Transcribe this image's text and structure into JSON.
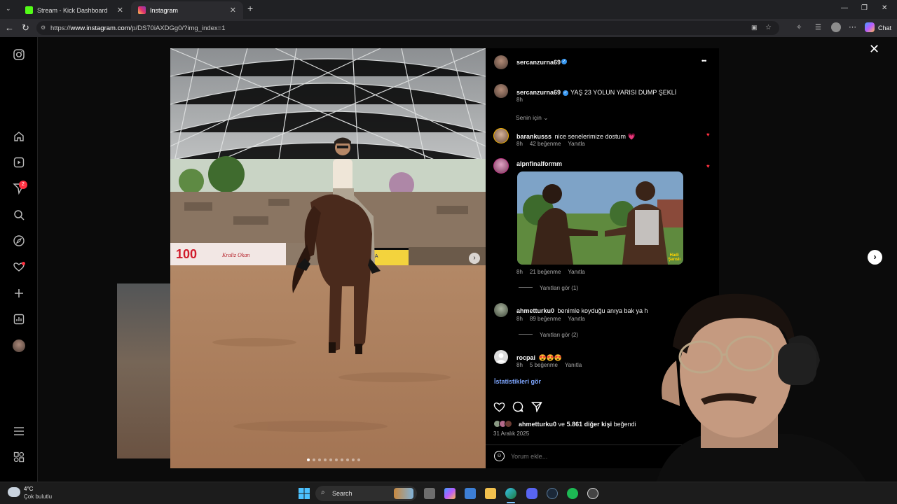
{
  "browser": {
    "tabs": [
      {
        "title": "Stream - Kick Dashboard",
        "favicon_color": "#53fc18"
      },
      {
        "title": "Instagram",
        "favicon_color": "#e1306c"
      }
    ],
    "url_prefix": "https://",
    "url_host": "www.instagram.com",
    "url_path": "/p/DS70iAXDGg0/?img_index=1",
    "chat_label": "Chat"
  },
  "sidebar": {
    "notification_count": "2",
    "icons": [
      "instagram-logo-icon",
      "home-icon",
      "reels-icon",
      "messages-icon",
      "search-icon",
      "explore-icon",
      "notifications-icon",
      "create-icon",
      "dashboard-icon",
      "profile-icon",
      "more-icon",
      "meta-apps-icon"
    ]
  },
  "post": {
    "author": "sercanzurna69",
    "caption": "YAŞ 23 YOLUN YARISI DUMP ŞEKLİ",
    "caption_time": "8h",
    "sort_label": "Senin için",
    "more_glyph": "•••",
    "comments": [
      {
        "user": "barankusss",
        "text": "nice senelerimize dostum 💗",
        "time": "8h",
        "likes": "42 beğenme",
        "reply": "Yanıtla",
        "avatar_color": "#8a6d52"
      },
      {
        "user": "alpnfinalformm",
        "text": "",
        "time": "8h",
        "likes": "21 beğenme",
        "reply": "Yanıtla",
        "view_replies": "Yanıtları gör (1)",
        "avatar_color": "#9c5a7e",
        "gif_badge": "Hadi\nŞanslı"
      },
      {
        "user": "ahmetturku0",
        "text": "benimle koyduğu anıya bak ya h",
        "time": "8h",
        "likes": "89 beğenme",
        "reply": "Yanıtla",
        "view_replies": "Yanıtları gör (2)",
        "avatar_color": "#5c6a5a"
      },
      {
        "user": "rocpai",
        "text": "😍😍😍",
        "time": "8h",
        "likes": "5 beğenme",
        "reply": "Yanıtla",
        "avatar_color": "#dbdbdb"
      }
    ],
    "insights_link": "İstatistikleri gör",
    "liked_by_user": "ahmetturku0",
    "liked_by_rest": "5.861 diğer kişi",
    "liked_by_ve": "ve",
    "liked_by_suffix": "beğendi",
    "date": "31 Aralık 2025",
    "comment_placeholder": "Yorum ekle...",
    "carousel_dots": 10,
    "carousel_active_index": 0
  },
  "photo_signs": {
    "left_sign": "100",
    "left_sign_text": "Kraliz Okan",
    "right_sign": "LA"
  },
  "taskbar": {
    "weather_temp": "4°C",
    "weather_desc": "Çok bulutlu",
    "search_label": "Search"
  }
}
